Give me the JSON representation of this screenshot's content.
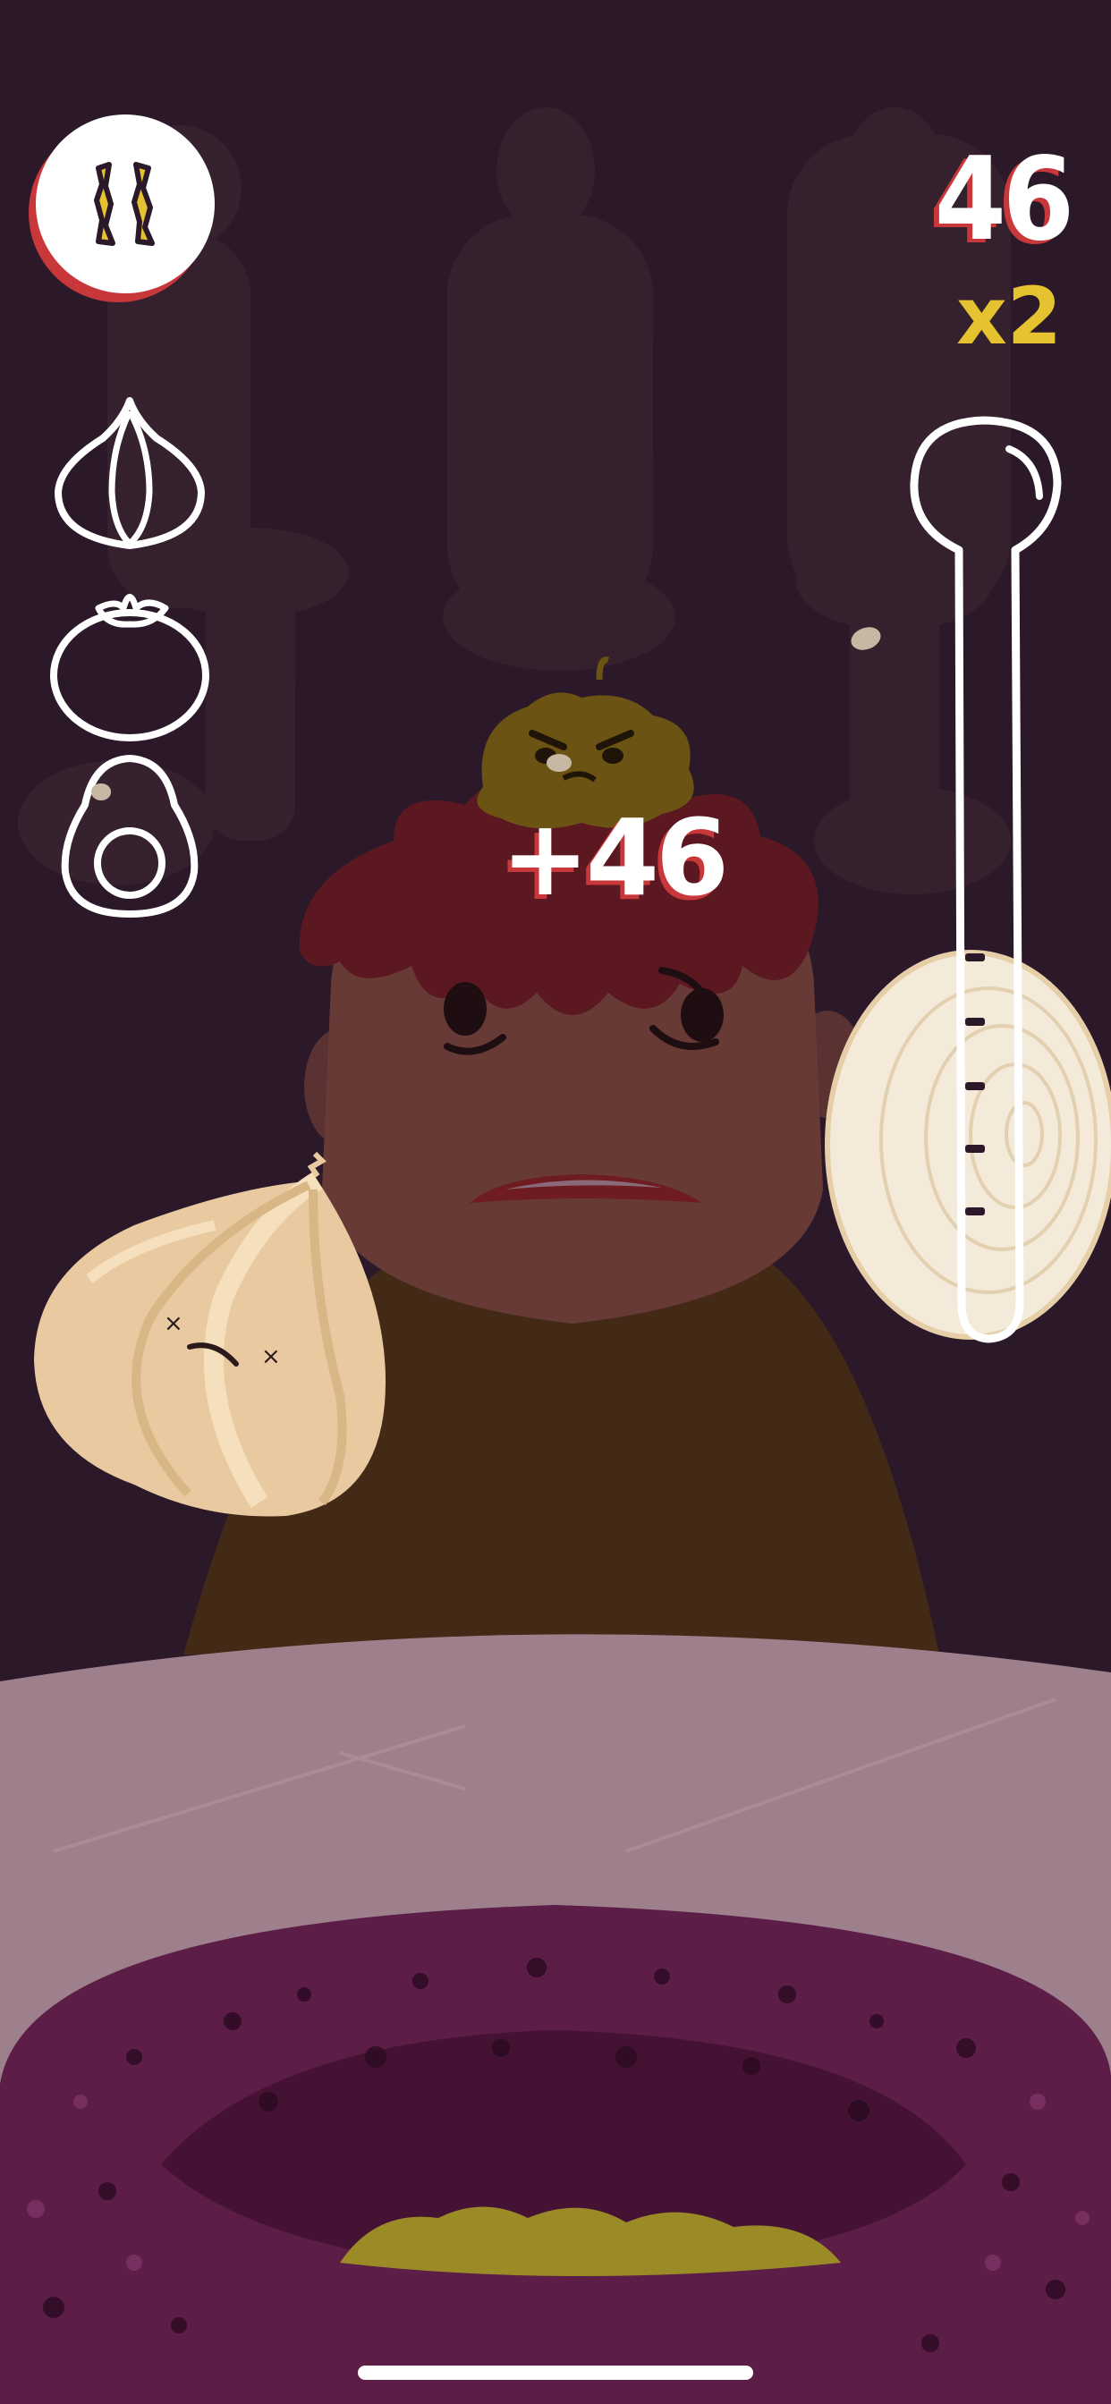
{
  "hud": {
    "score": "46",
    "multiplier": "x2",
    "score_popup": "+46",
    "pause_icon": "pause-icon"
  },
  "ingredients": [
    {
      "name": "garlic",
      "icon": "garlic-icon"
    },
    {
      "name": "tomato",
      "icon": "tomato-icon"
    },
    {
      "name": "avocado",
      "icon": "avocado-icon"
    }
  ],
  "heat_meter": {
    "icon": "thermometer-icon",
    "ticks": 5
  },
  "colors": {
    "background": "#2b1829",
    "accent_red": "#c8383a",
    "multiplier_yellow": "#e4c230",
    "hud_white": "#ffffff"
  }
}
